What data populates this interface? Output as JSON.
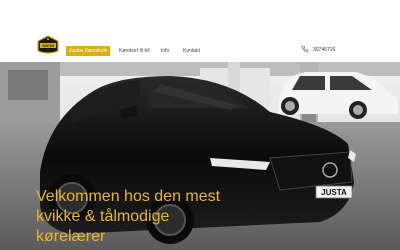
{
  "header": {
    "logo": {
      "alt": "logo",
      "text": "JUSTAS"
    },
    "nav": [
      {
        "label": "Justas Køreskole",
        "active": true
      },
      {
        "label": "Kørekort til bil",
        "active": false
      },
      {
        "label": "Info",
        "active": false
      },
      {
        "label": "Kontakt",
        "active": false
      }
    ],
    "phone": "30746716"
  },
  "hero": {
    "plate_text": "JUSTA",
    "headline_lines": [
      "Velkommen hos den mest",
      "kvikke & tålmodige",
      "kørelærer"
    ]
  },
  "colors": {
    "accent": "#d7b013",
    "headline": "#e8b72a"
  }
}
